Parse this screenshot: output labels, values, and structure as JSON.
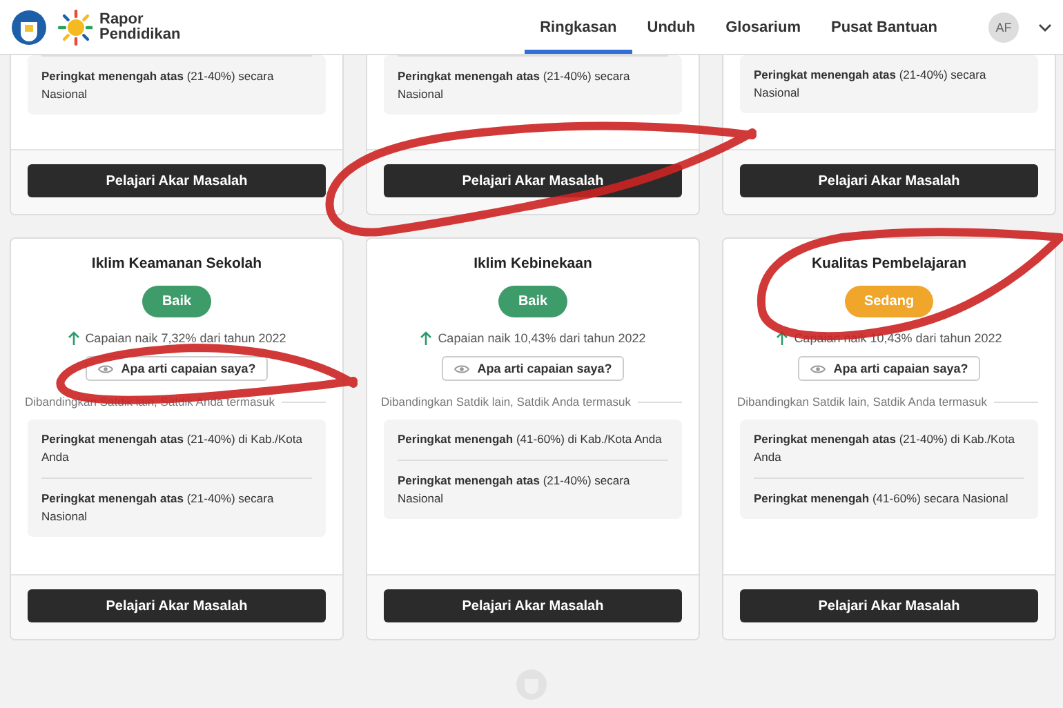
{
  "header": {
    "logo_text": "Rapor Pendidikan",
    "nav": [
      {
        "label": "Ringkasan",
        "selected": true
      },
      {
        "label": "Unduh",
        "selected": false
      },
      {
        "label": "Glosarium",
        "selected": false
      },
      {
        "label": "Pusat Bantuan",
        "selected": false
      }
    ],
    "avatar": "AF"
  },
  "top_cards": [
    {
      "divider_above": true,
      "items": [
        "**Peringkat menengah atas** (21-40%) secara Nasional"
      ],
      "button": "Pelajari Akar Masalah"
    },
    {
      "divider_above": true,
      "items": [
        "**Peringkat menengah atas** (21-40%) secara Nasional"
      ],
      "button": "Pelajari Akar Masalah"
    },
    {
      "divider_above": false,
      "items": [
        "**Peringkat menengah atas** (21-40%) secara Nasional"
      ],
      "button": "Pelajari Akar Masalah"
    }
  ],
  "cards": [
    {
      "title": "Iklim Keamanan Sekolah",
      "status": "Baik",
      "color": "#3e9c6a",
      "change": "Capaian naik 7,32% dari tahun 2022",
      "help": "Apa arti capaian saya?",
      "compare": "Dibandingkan Satdik lain, Satdik Anda termasuk",
      "items": [
        "**Peringkat menengah atas** (21-40%) di Kab./Kota Anda",
        "**Peringkat menengah atas** (21-40%) secara Nasional"
      ],
      "button": "Pelajari Akar Masalah"
    },
    {
      "title": "Iklim Kebinekaan",
      "status": "Baik",
      "color": "#3e9c6a",
      "change": "Capaian naik 10,43% dari tahun 2022",
      "help": "Apa arti capaian saya?",
      "compare": "Dibandingkan Satdik lain, Satdik Anda termasuk",
      "items": [
        "**Peringkat menengah** (41-60%) di Kab./Kota Anda",
        "**Peringkat menengah atas** (21-40%) secara Nasional"
      ],
      "button": "Pelajari Akar Masalah"
    },
    {
      "title": "Kualitas Pembelajaran",
      "status": "Sedang",
      "color": "#f0a52b",
      "change": "Capaian naik 10,43% dari tahun 2022",
      "help": "Apa arti capaian saya?",
      "compare": "Dibandingkan Satdik lain, Satdik Anda termasuk",
      "items": [
        "**Peringkat menengah atas** (21-40%) di Kab./Kota Anda",
        "**Peringkat menengah** (41-60%) secara Nasional"
      ],
      "button": "Pelajari Akar Masalah"
    }
  ],
  "annotations": [
    {
      "kind": "loop"
    },
    {
      "kind": "loop"
    },
    {
      "kind": "loop"
    }
  ]
}
